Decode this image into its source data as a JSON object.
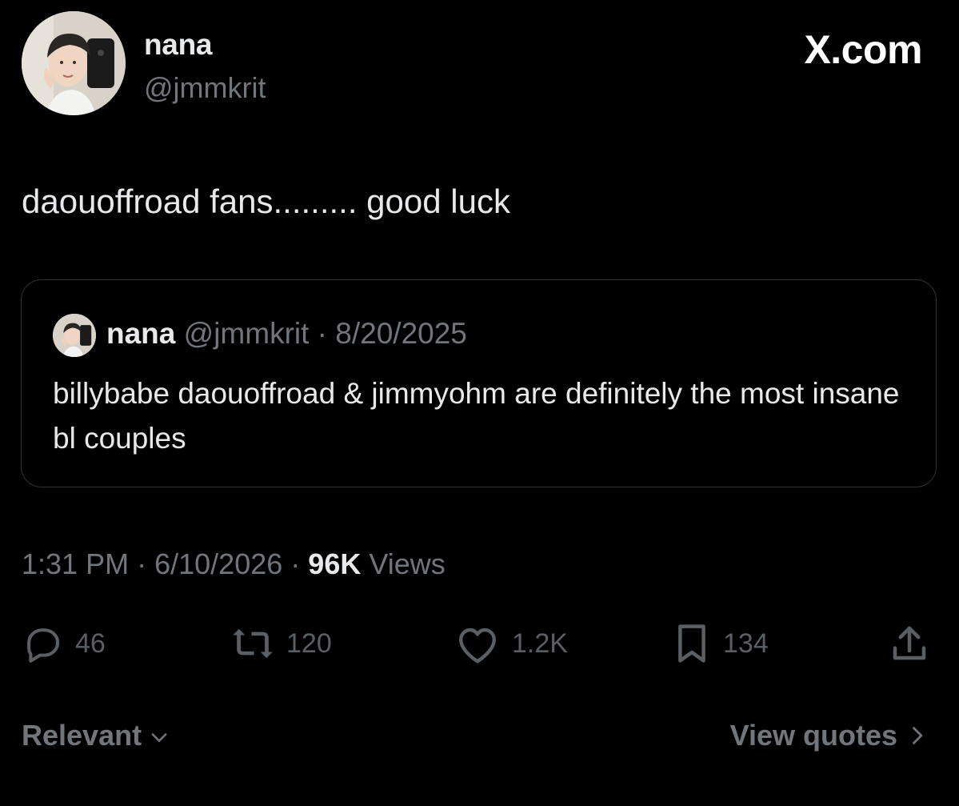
{
  "brand": "X.com",
  "author": {
    "display_name": "nana",
    "handle": "@jmmkrit"
  },
  "tweet": {
    "text": "daouoffroad fans......... good luck"
  },
  "quoted": {
    "display_name": "nana",
    "handle": "@jmmkrit",
    "separator": "·",
    "date": "8/20/2025",
    "text": "billybabe daouoffroad & jimmyohm are definitely the most insane bl couples"
  },
  "meta": {
    "time": "1:31 PM",
    "separator": "·",
    "date": "6/10/2026",
    "views_count": "96K",
    "views_label": "Views"
  },
  "actions": {
    "replies": "46",
    "reposts": "120",
    "likes": "1.2K",
    "bookmarks": "134"
  },
  "footer": {
    "sort_label": "Relevant",
    "view_quotes_label": "View quotes"
  },
  "icons": {
    "reply": "speech-bubble-icon",
    "repost": "repost-arrows-icon",
    "like": "heart-icon",
    "bookmark": "bookmark-icon",
    "share": "share-upload-icon"
  },
  "colors": {
    "background": "#000000",
    "primary_text": "#e7e9ea",
    "secondary_text": "#71767b",
    "border": "#2f3336"
  }
}
